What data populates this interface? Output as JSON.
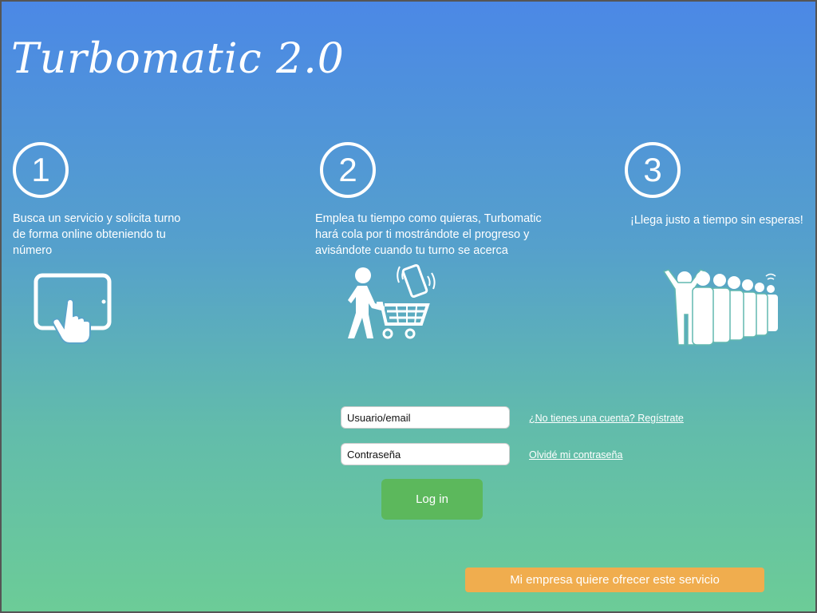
{
  "app": {
    "title": "Turbomatic 2.0"
  },
  "steps": [
    {
      "number": "1",
      "text": "Busca un servicio y solicita turno de forma online obteniendo tu número",
      "icon": "tablet-touch-icon"
    },
    {
      "number": "2",
      "text": "Emplea tu tiempo como quieras, Turbomatic hará cola por ti mostrándote el progreso y avisándote cuando tu turno se acerca",
      "icon": "shopping-cart-phone-icon"
    },
    {
      "number": "3",
      "text": "¡Llega justo a tiempo sin esperas!",
      "icon": "queue-people-icon"
    }
  ],
  "login": {
    "user_placeholder": "Usuario/email",
    "password_placeholder": "Contraseña",
    "register_link": "¿No tienes una cuenta? Regístrate",
    "forgot_link": "Olvidé mi contraseña",
    "login_button": "Log in"
  },
  "business_button": "Mi empresa quiere ofrecer este servicio",
  "colors": {
    "login_button": "#5cb85c",
    "business_button": "#f0ad4e"
  }
}
